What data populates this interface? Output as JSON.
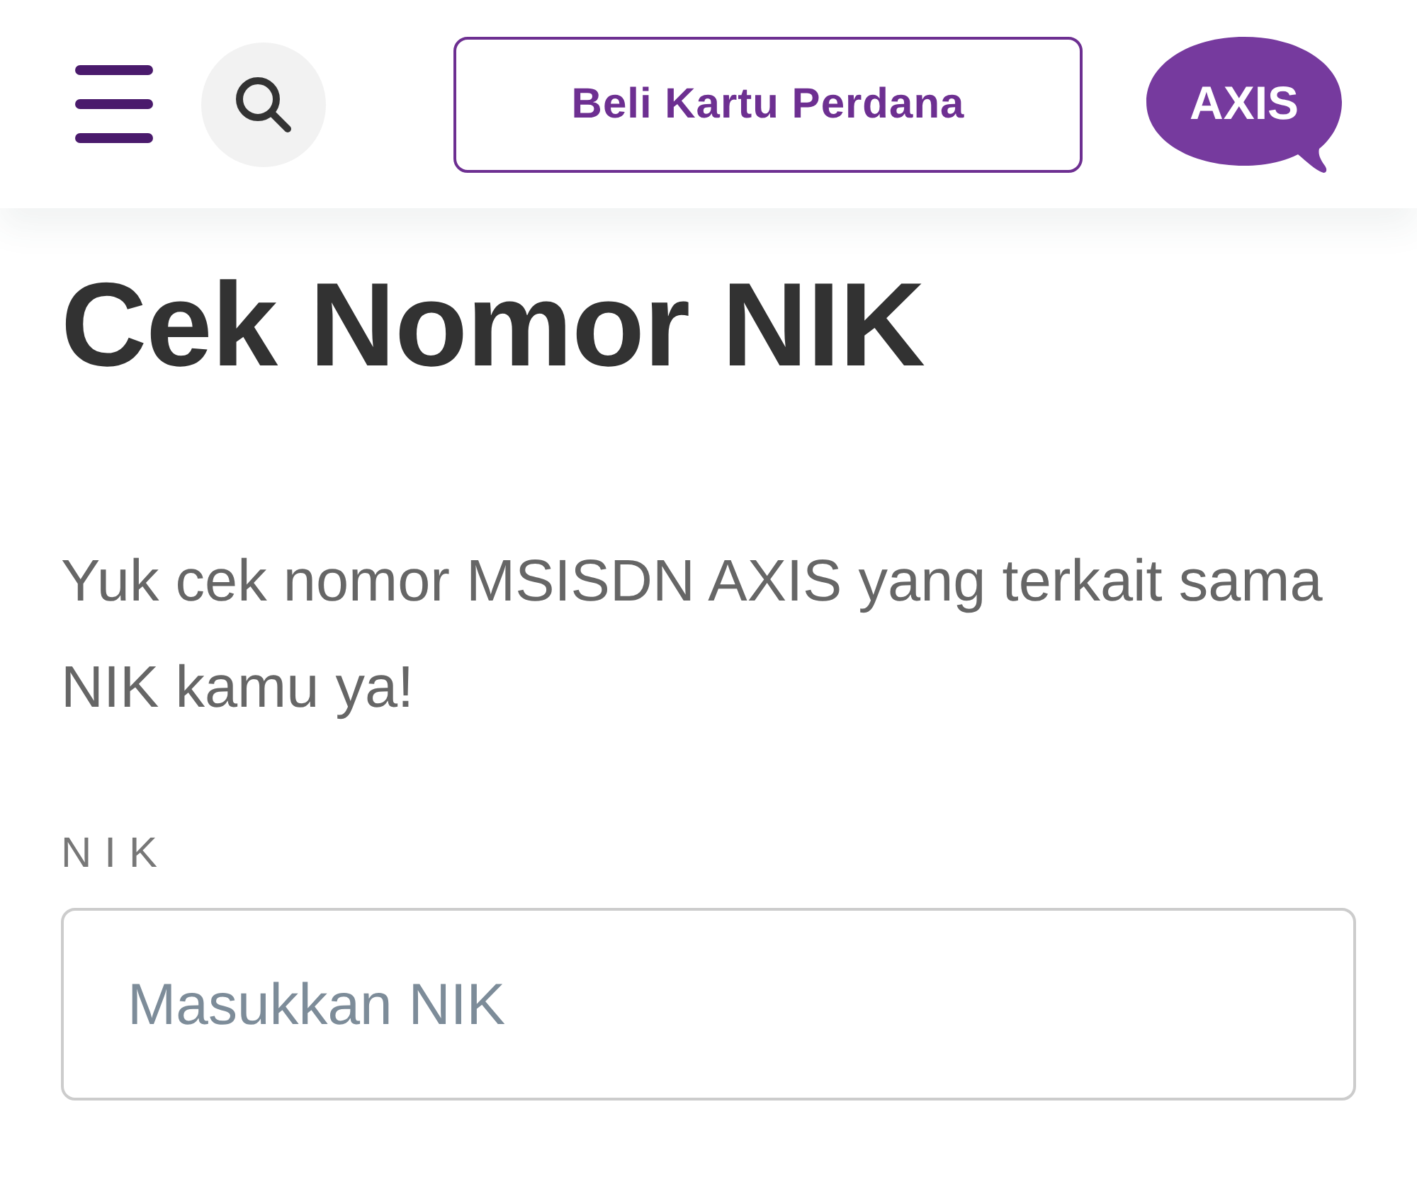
{
  "header": {
    "buttons": [
      {
        "label": "Beli Kartu Perdana"
      }
    ],
    "logo": {
      "text": "AXIS"
    }
  },
  "title": "Cek Nomor NIK",
  "description": "Yuk cek nomor MSISDN AXIS yang terkait sama NIK kamu ya!",
  "form": {
    "fields": [
      {
        "label": "NIK",
        "placeholder": "Masukkan NIK"
      }
    ]
  }
}
